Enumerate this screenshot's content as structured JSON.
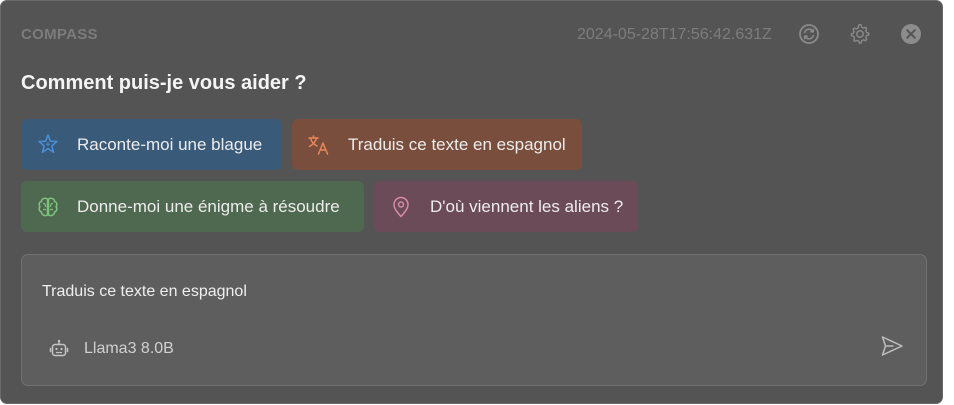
{
  "header": {
    "brand": "COMPASS",
    "timestamp": "2024-05-28T17:56:42.631Z",
    "icons": [
      "refresh-icon",
      "gear-icon",
      "close-icon"
    ]
  },
  "main": {
    "heading": "Comment puis-je vous aider ?",
    "suggestions": [
      {
        "label": "Raconte-moi une blague",
        "icon": "sparkle-star-icon",
        "color": "#3a5a7a",
        "icon_color": "#4a90d9"
      },
      {
        "label": "Traduis ce texte en espagnol",
        "icon": "translate-icon",
        "color": "#7a4e3c",
        "icon_color": "#e8875a"
      },
      {
        "label": "Donne-moi une énigme à résoudre",
        "icon": "brain-icon",
        "color": "#4f6850",
        "icon_color": "#7ec27f"
      },
      {
        "label": "D'où viennent les aliens ?",
        "icon": "map-pin-icon",
        "color": "#6c4b58",
        "icon_color": "#d88aa6"
      }
    ]
  },
  "composer": {
    "input_value": "Traduis ce texte en espagnol",
    "model": "Llama3 8.0B",
    "model_icon": "robot-icon",
    "send_icon": "send-icon"
  }
}
